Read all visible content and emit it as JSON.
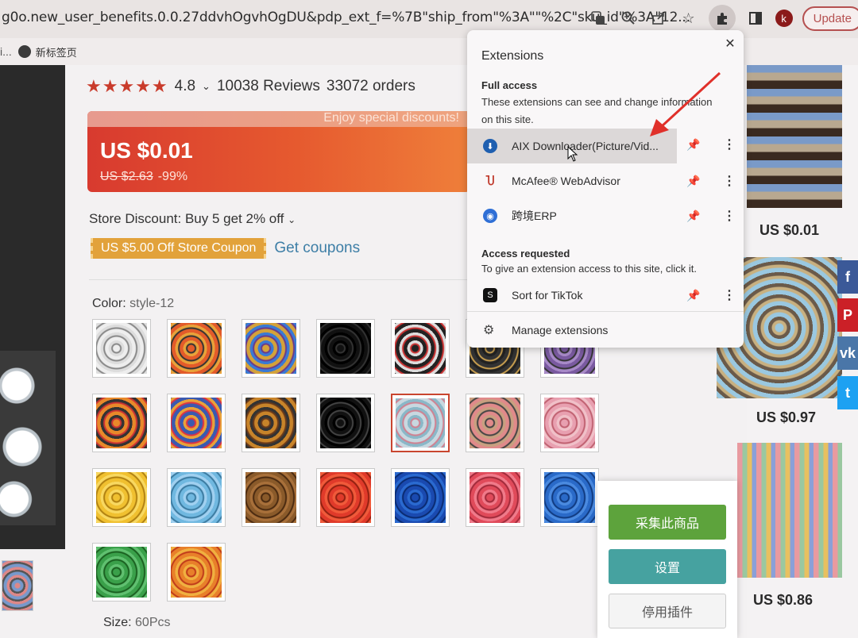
{
  "browser": {
    "url": "g0o.new_user_benefits.0.0.27ddvhOgvhOgDU&pdp_ext_f=%7B\"ship_from\"%3A\"\"%2C\"sku_id\"%3A\"12...",
    "update_label": "Update",
    "profile_initial": "k",
    "bookmark": "新标签页",
    "bookmark_prefix": "i..."
  },
  "product": {
    "rating": "4.8",
    "reviews": "10038 Reviews",
    "orders": "33072 orders",
    "promo_banner": "Enjoy special discounts!",
    "price": "US $0.01",
    "old_price": "US $2.63",
    "discount": "-99%",
    "store_discount": "Store Discount: Buy 5 get 2% off",
    "coupon": "US $5.00 Off Store Coupon",
    "get_coupons": "Get coupons",
    "color_label": "Color:",
    "color_value": "style-12",
    "size_label": "Size:",
    "size_value": "60Pcs"
  },
  "extensions_popup": {
    "title": "Extensions",
    "full_access_heading": "Full access",
    "full_access_desc": "These extensions can see and change information on this site.",
    "full_access_items": [
      {
        "name": "AIX Downloader(Picture/Vid...",
        "icon_color": "#1f5fb0"
      },
      {
        "name": "McAfee® WebAdvisor",
        "icon_color": "#c0392b"
      },
      {
        "name": "跨境ERP",
        "icon_color": "#2f6fd6"
      }
    ],
    "access_requested_heading": "Access requested",
    "access_requested_desc": "To give an extension access to this site, click it.",
    "requested_items": [
      {
        "name": "Sort for TikTok",
        "icon_color": "#111111"
      }
    ],
    "manage_label": "Manage extensions"
  },
  "plugin_panel": {
    "collect": "采集此商品",
    "settings": "设置",
    "disable": "停用插件"
  },
  "related": {
    "prices": [
      "US $0.01",
      "US $0.97",
      "US $0.86"
    ]
  },
  "colors": {
    "accent_red": "#d83a2f",
    "coupon_orange": "#e2a23b",
    "link_blue": "#3d7ea6",
    "plugin_green": "#5da33c",
    "plugin_teal": "#46a2a0"
  }
}
